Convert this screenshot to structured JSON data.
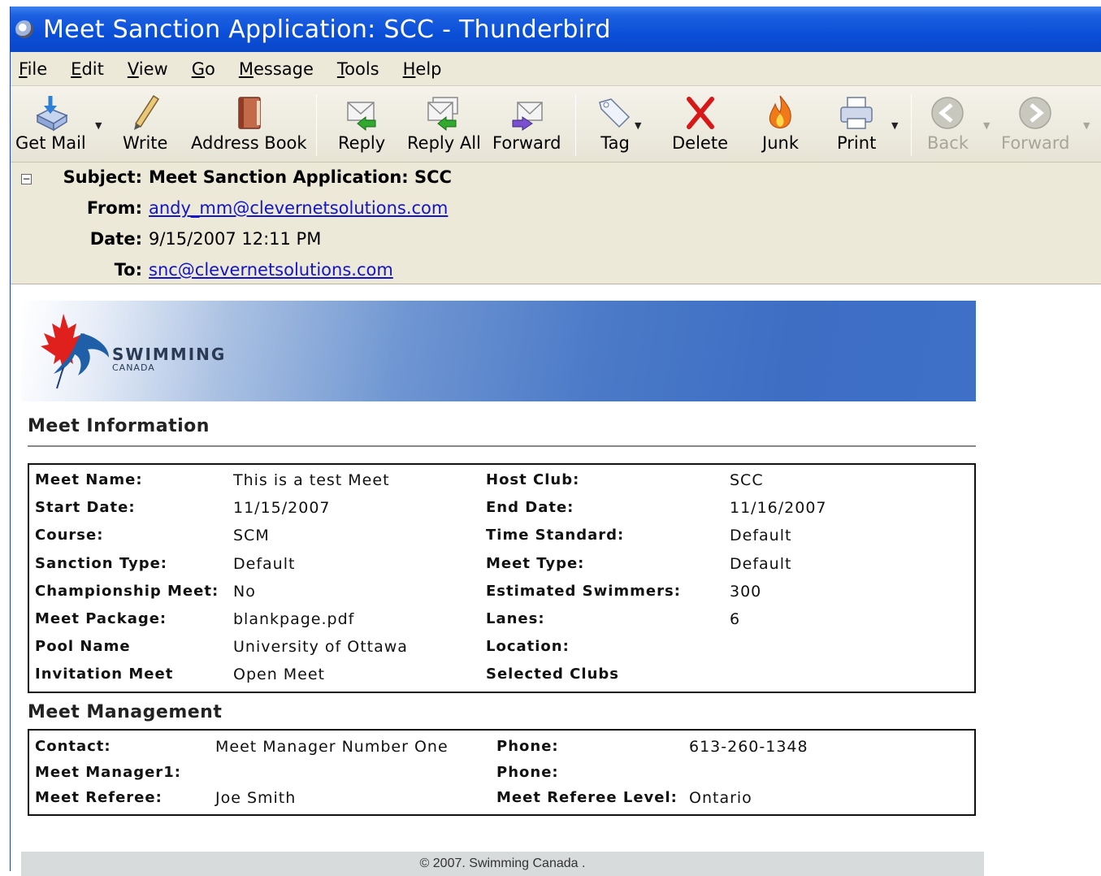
{
  "window": {
    "title": "Meet Sanction Application:  SCC - Thunderbird"
  },
  "menu": [
    {
      "label": "File",
      "u": "F",
      "rest": "ile"
    },
    {
      "label": "Edit",
      "u": "E",
      "rest": "dit"
    },
    {
      "label": "View",
      "u": "V",
      "rest": "iew"
    },
    {
      "label": "Go",
      "u": "G",
      "rest": "o"
    },
    {
      "label": "Message",
      "u": "M",
      "rest": "essage"
    },
    {
      "label": "Tools",
      "u": "T",
      "rest": "ools"
    },
    {
      "label": "Help",
      "u": "H",
      "rest": "elp"
    }
  ],
  "toolbar": {
    "get_mail": "Get Mail",
    "write": "Write",
    "address_book": "Address Book",
    "reply": "Reply",
    "reply_all": "Reply All",
    "forward": "Forward",
    "tag": "Tag",
    "delete": "Delete",
    "junk": "Junk",
    "print": "Print",
    "back": "Back",
    "forward_nav": "Forward"
  },
  "header": {
    "subject_label": "Subject:",
    "subject": "Meet Sanction Application:  SCC",
    "from_label": "From:",
    "from": "andy_mm@clevernetsolutions.com",
    "date_label": "Date:",
    "date": "9/15/2007 12:11 PM",
    "to_label": "To:",
    "to": "snc@clevernetsolutions.com"
  },
  "banner": {
    "logo_big": "SWIMMING",
    "logo_small": "CANADA"
  },
  "meet_info": {
    "title": "Meet Information",
    "rows": [
      {
        "l1": "Meet Name:",
        "v1": "This is a test Meet",
        "l2": "Host Club:",
        "v2": "SCC"
      },
      {
        "l1": "Start Date:",
        "v1": "11/15/2007",
        "l2": "End Date:",
        "v2": "11/16/2007"
      },
      {
        "l1": "Course:",
        "v1": "SCM",
        "l2": "Time Standard:",
        "v2": "Default"
      },
      {
        "l1": "Sanction Type:",
        "v1": "Default",
        "l2": "Meet Type:",
        "v2": "Default"
      },
      {
        "l1": "Championship Meet:",
        "v1": "No",
        "l2": "Estimated Swimmers:",
        "v2": "300"
      },
      {
        "l1": "Meet Package:",
        "v1": "blankpage.pdf",
        "l2": "Lanes:",
        "v2": "6"
      },
      {
        "l1": "Pool Name",
        "v1": "University of Ottawa",
        "l2": "Location:",
        "v2": ""
      },
      {
        "l1": "Invitation Meet",
        "v1": "Open Meet",
        "l2": "Selected Clubs",
        "v2": ""
      }
    ]
  },
  "meet_mgmt": {
    "title": "Meet Management",
    "rows": [
      {
        "l1": "Contact:",
        "v1": "Meet Manager Number One",
        "l2": "Phone:",
        "v2": "613-260-1348"
      },
      {
        "l1": "Meet Manager1:",
        "v1": "",
        "l2": "Phone:",
        "v2": ""
      },
      {
        "l1": "Meet Referee:",
        "v1": "Joe Smith",
        "l2": "Meet Referee Level:",
        "v2": "Ontario"
      }
    ]
  },
  "footer": "© 2007. Swimming Canada ."
}
